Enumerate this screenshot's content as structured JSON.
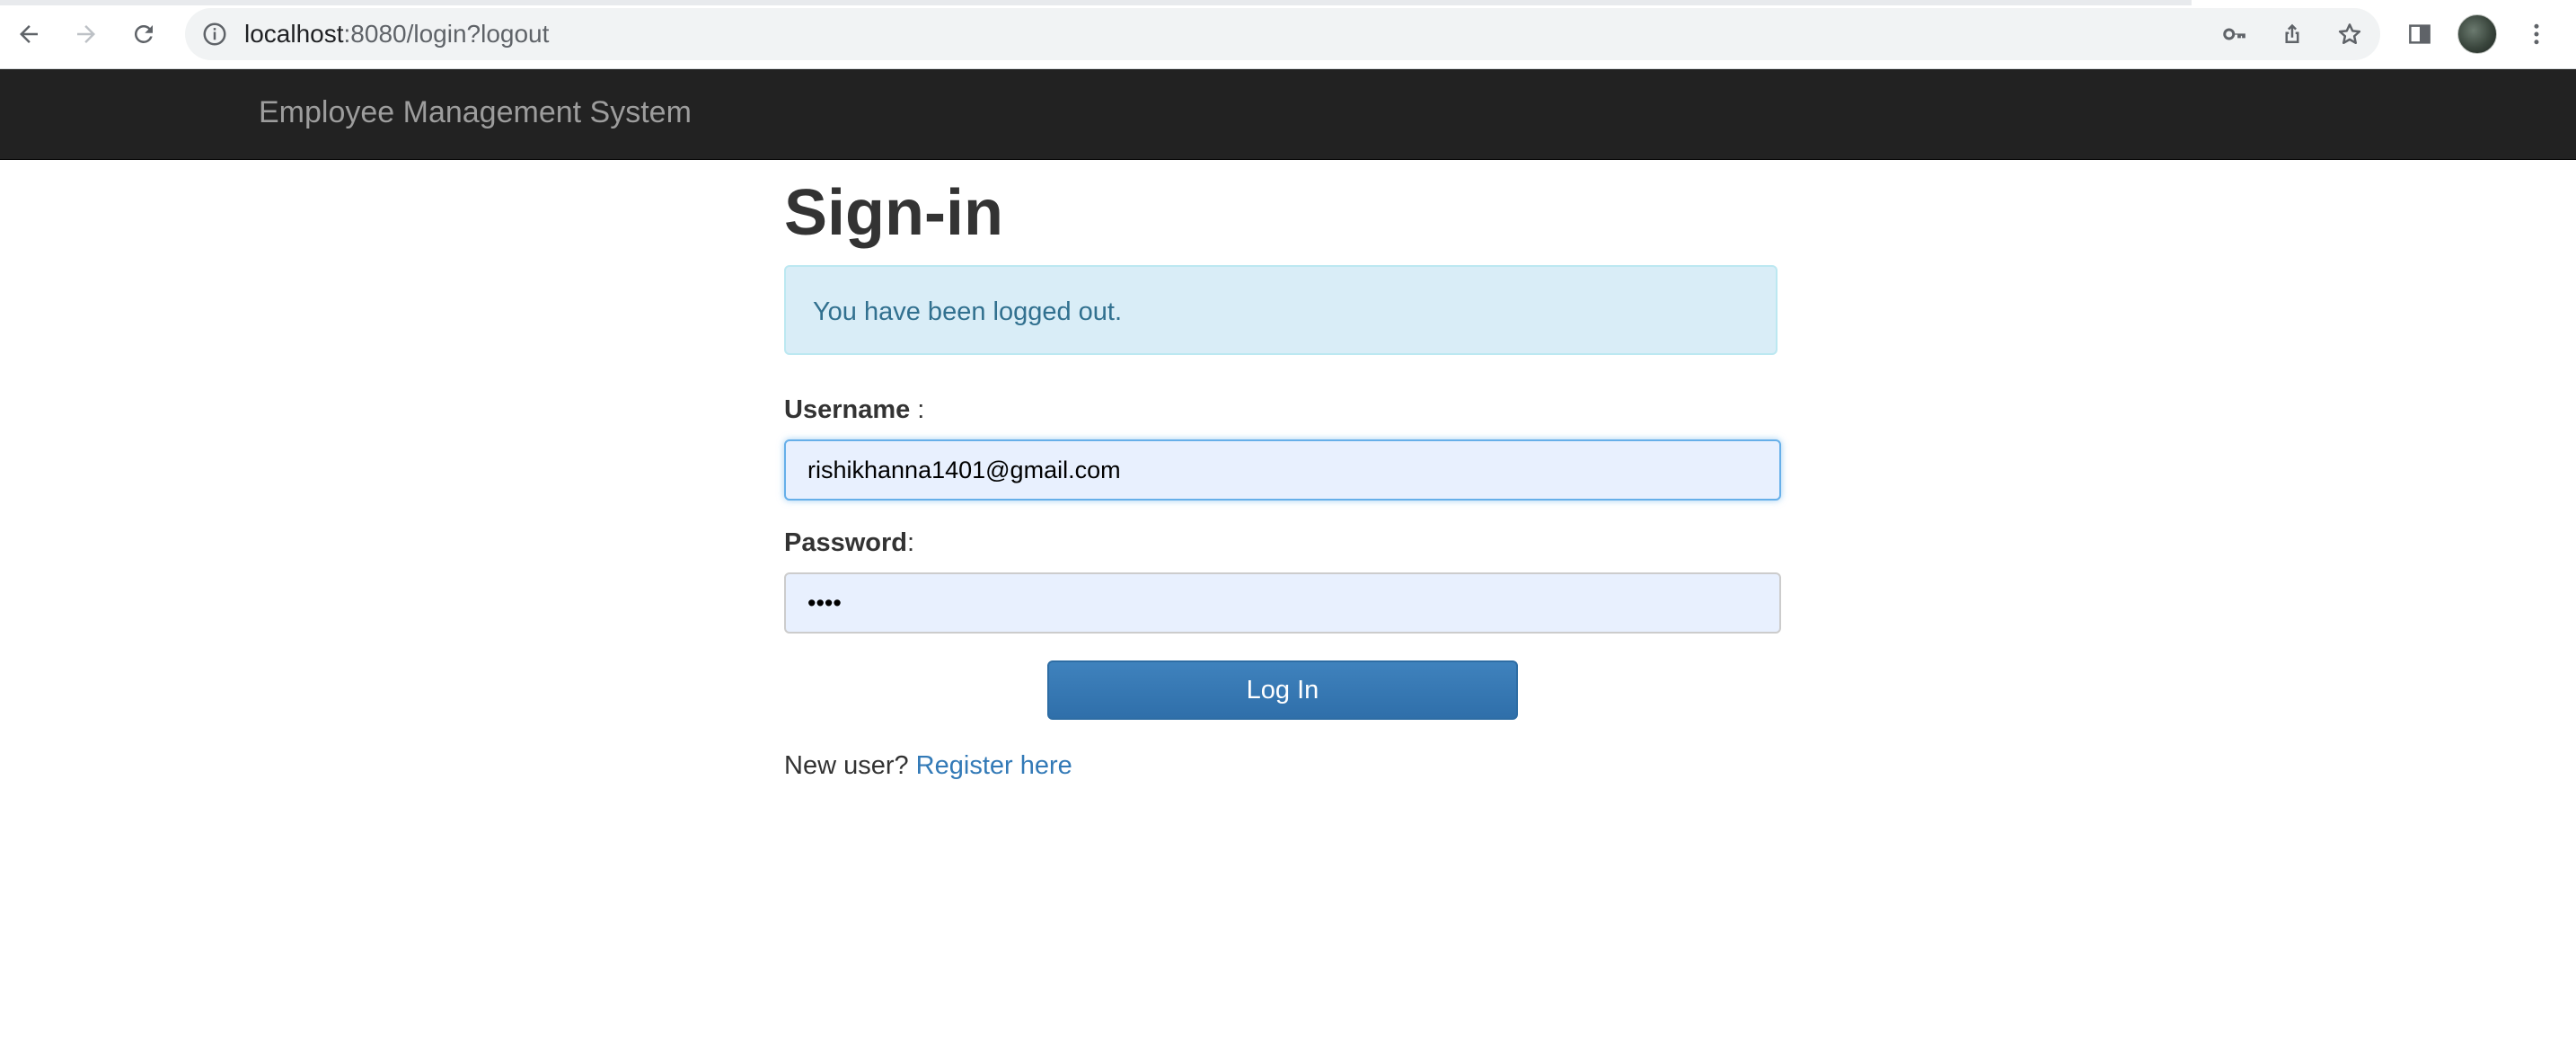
{
  "browser": {
    "url_host": "localhost",
    "url_path": ":8080/login?logout",
    "icons": [
      "back-icon",
      "forward-icon",
      "reload-icon",
      "info-icon",
      "key-icon",
      "share-icon",
      "star-icon",
      "side-panel-icon",
      "profile-avatar",
      "more-icon"
    ]
  },
  "navbar": {
    "brand": "Employee Management System"
  },
  "page": {
    "title": "Sign-in",
    "alert": "You have been logged out.",
    "username_label": "Username",
    "username_suffix": " :",
    "username_value": "rishikhanna1401@gmail.com",
    "password_label": "Password",
    "password_suffix": ":",
    "password_value": "••••",
    "login_button": "Log In",
    "new_user_text": "New user? ",
    "register_link": "Register here"
  },
  "colors": {
    "navbar_bg": "#222222",
    "brand_text": "#9d9d9d",
    "alert_bg": "#d9edf7",
    "alert_text": "#31708f",
    "primary": "#337ab7",
    "input_autofill_bg": "#e8f0fe"
  }
}
